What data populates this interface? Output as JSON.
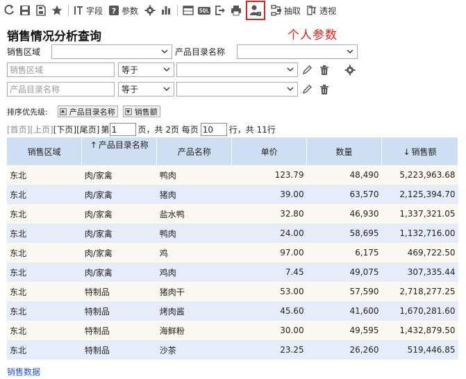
{
  "toolbar": {
    "fields_label": "字段",
    "params_label": "参数",
    "extract_label": "抽取",
    "pivot_label": "透视",
    "sql_label": "SQL"
  },
  "page": {
    "title": "销售情况分析查询",
    "annotation": "个人参数"
  },
  "filters": {
    "region_label": "销售区域",
    "region_value": "",
    "catalog_label": "产品目录名称",
    "catalog_value": "",
    "cond1": {
      "field_placeholder": "销售区域",
      "operator": "等于",
      "value": ""
    },
    "cond2": {
      "field_placeholder": "产品目录名称",
      "operator": "等于",
      "value": ""
    }
  },
  "sort": {
    "label": "排序优先级:",
    "items": [
      {
        "label": "产品目录名称",
        "direction": "asc"
      },
      {
        "label": "销售额",
        "direction": "desc"
      }
    ]
  },
  "pager": {
    "first": "[首页]",
    "prev": "[上页]",
    "next": "[下页]",
    "last": "[尾页]",
    "page_prefix": "第",
    "current_page": "1",
    "page_suffix": "页，共 2页 每页",
    "page_size": "10",
    "rows_suffix": "行，共 11行"
  },
  "table": {
    "columns": [
      {
        "label": "销售区域",
        "sort": ""
      },
      {
        "label": "产品目录名称",
        "sort": "↑"
      },
      {
        "label": "产品名称",
        "sort": ""
      },
      {
        "label": "单价",
        "sort": ""
      },
      {
        "label": "数量",
        "sort": ""
      },
      {
        "label": "销售额",
        "sort": "↓"
      }
    ],
    "rows": [
      [
        "东北",
        "肉/家禽",
        "鸭肉",
        "123.79",
        "48,490",
        "5,223,963.68"
      ],
      [
        "东北",
        "肉/家禽",
        "猪肉",
        "39.00",
        "63,570",
        "2,125,394.70"
      ],
      [
        "东北",
        "肉/家禽",
        "盐水鸭",
        "32.80",
        "46,930",
        "1,337,321.05"
      ],
      [
        "东北",
        "肉/家禽",
        "鸭肉",
        "24.00",
        "58,695",
        "1,132,716.00"
      ],
      [
        "东北",
        "肉/家禽",
        "鸡",
        "97.00",
        "6,175",
        "469,722.50"
      ],
      [
        "东北",
        "肉/家禽",
        "鸡肉",
        "7.45",
        "49,075",
        "307,335.44"
      ],
      [
        "东北",
        "特制品",
        "猪肉干",
        "53.00",
        "57,590",
        "2,718,277.25"
      ],
      [
        "东北",
        "特制品",
        "烤肉酱",
        "45.60",
        "41,600",
        "1,670,281.60"
      ],
      [
        "东北",
        "特制品",
        "海鲜粉",
        "30.00",
        "49,595",
        "1,432,879.50"
      ],
      [
        "东北",
        "特制品",
        "沙茶",
        "23.25",
        "26,260",
        "519,446.85"
      ]
    ]
  },
  "footer": {
    "link": "销售数据"
  },
  "colors": {
    "accent": "#e0201a",
    "header_bg": "#cfdff3",
    "row_odd": "#fbf8f1",
    "row_even": "#e7ecfb",
    "link": "#1a4fd6"
  },
  "icons": [
    "refresh-icon",
    "save-icon",
    "save-as-icon",
    "favorite-icon",
    "fields-icon",
    "params-icon",
    "settings-icon",
    "chart-icon",
    "table-icon",
    "sql-icon",
    "export-icon",
    "print-icon",
    "personal-params-icon",
    "extract-icon",
    "pivot-icon"
  ]
}
